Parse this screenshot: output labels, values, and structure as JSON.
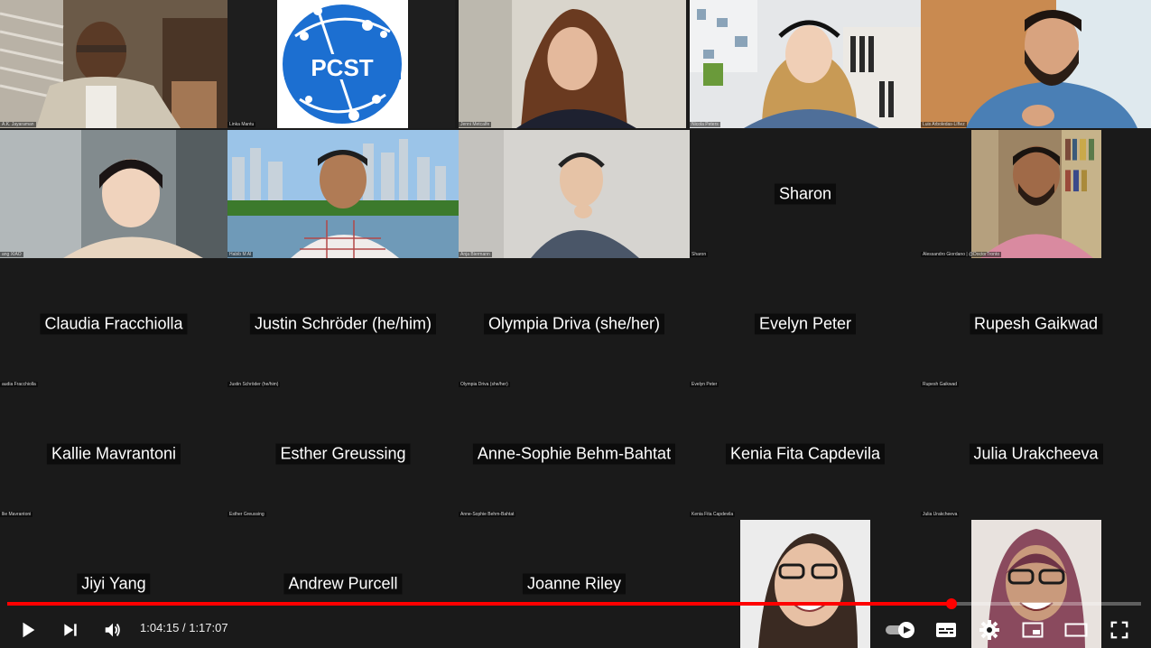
{
  "video_tiles": [
    {
      "id": "t1",
      "tag": "A.K. Jayaraman"
    },
    {
      "id": "t2",
      "tag": "Linka Mantu"
    },
    {
      "id": "t3",
      "tag": "Jenni Metcalfe"
    },
    {
      "id": "t4",
      "tag": "Nicola Peters"
    },
    {
      "id": "t5",
      "tag": "Luis Arboledas-Líñez"
    },
    {
      "id": "t6",
      "tag": "ang XIAO"
    },
    {
      "id": "t7",
      "tag": "Habib M Al"
    },
    {
      "id": "t8",
      "tag": "Anja Biermann"
    },
    {
      "id": "t10",
      "tag": "Alessandro Giordano | @DoctorTronto"
    }
  ],
  "logo": {
    "text": "PCST",
    "color": "#1c6fd1"
  },
  "name_tiles": [
    {
      "name": "Sharon",
      "tag": "Sharon"
    },
    {
      "name": "Claudia Fracchiolla",
      "tag": "audia Fracchiolla"
    },
    {
      "name": "Justin Schröder (he/him)",
      "tag": "Justin Schröder (he/him)"
    },
    {
      "name": "Olympia Driva (she/her)",
      "tag": "Olympia Driva (she/her)"
    },
    {
      "name": "Evelyn Peter",
      "tag": "Evelyn Peter"
    },
    {
      "name": "Rupesh Gaikwad",
      "tag": "Rupesh Gaikwad"
    },
    {
      "name": "Kallie Mavrantoni",
      "tag": "llie Mavrantoni"
    },
    {
      "name": "Esther Greussing",
      "tag": "Esther Greussing"
    },
    {
      "name": "Anne-Sophie Behm-Bahtat",
      "tag": "Anne-Sophie Behm-Bahtat"
    },
    {
      "name": "Kenia Fita Capdevila",
      "tag": "Kenia Fita Capdevila"
    },
    {
      "name": "Julia Urakcheeva",
      "tag": "Julia Urakcheeva"
    },
    {
      "name": "Jiyi Yang",
      "tag": ""
    },
    {
      "name": "Andrew Purcell",
      "tag": ""
    },
    {
      "name": "Joanne Riley",
      "tag": ""
    }
  ],
  "player": {
    "current_time": "1:04:15",
    "duration": "1:17:07",
    "time_display": "1:04:15 / 1:17:07",
    "progress": 0.833,
    "accent": "#ff0000",
    "icons": [
      "play-icon",
      "next-icon",
      "volume-icon",
      "autoplay-toggle-icon",
      "subtitles-icon",
      "settings-icon",
      "miniplayer-icon",
      "theater-icon",
      "fullscreen-icon"
    ]
  }
}
